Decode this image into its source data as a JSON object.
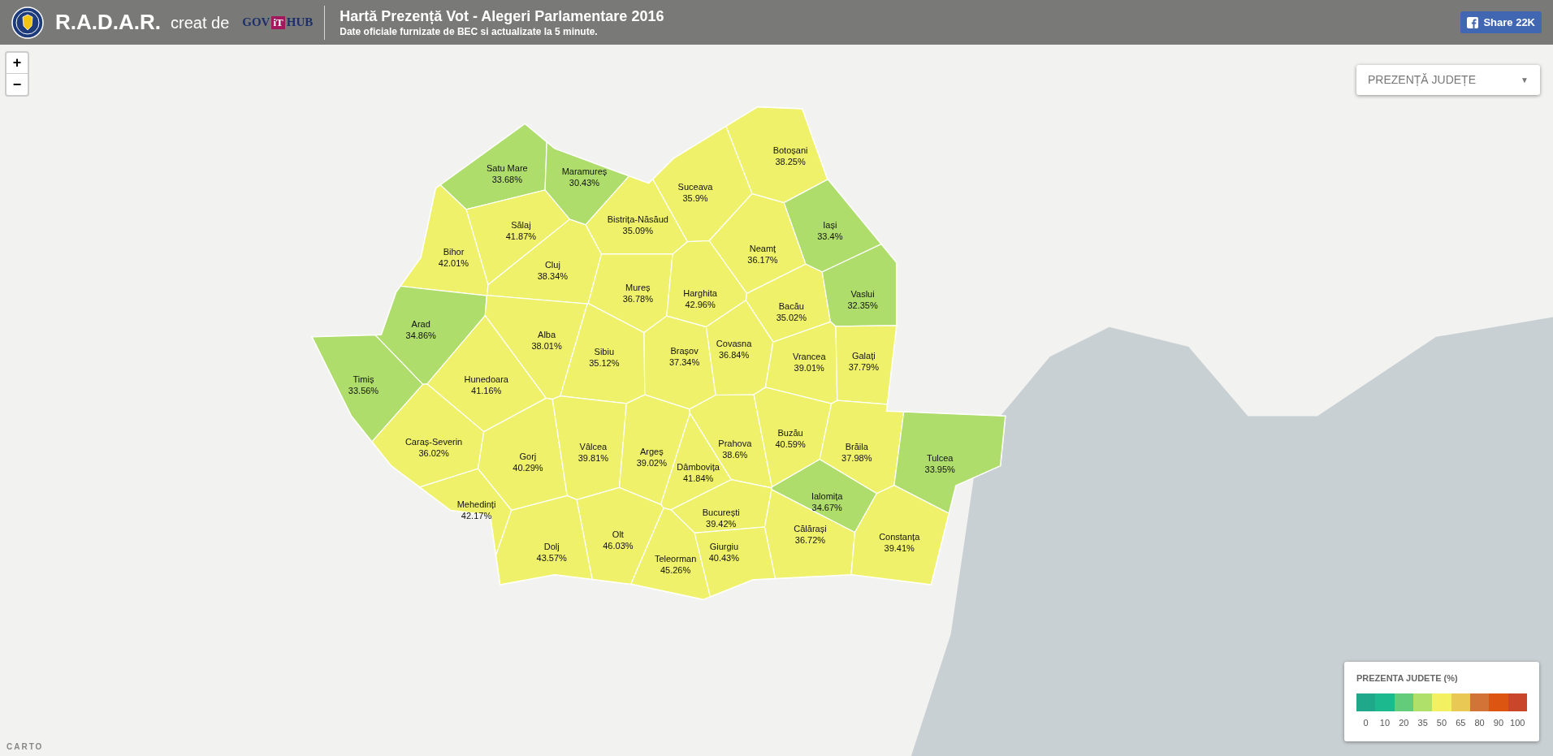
{
  "header": {
    "brand": "R.A.D.A.R.",
    "credit": "creat de",
    "partner": {
      "left": "GOV",
      "mid": "iT",
      "right": "HUB"
    },
    "title": "Hartă Prezență Vot - Alegeri Parlamentare 2016",
    "subtitle": "Date oficiale furnizate de BEC si actualizate la 5 minute.",
    "share": "Share 22K"
  },
  "zoom": [
    "+",
    "−"
  ],
  "layer_select": {
    "value": "PREZENȚĂ JUDEȚE",
    "caret": "▼"
  },
  "counties": [
    {
      "name": "Satu Mare",
      "turnout": "33.68%",
      "color": "#aedd6c"
    },
    {
      "name": "Maramureș",
      "turnout": "30.43%",
      "color": "#aedd6c"
    },
    {
      "name": "Botoșani",
      "turnout": "38.25%",
      "color": "#f0f16b"
    },
    {
      "name": "Suceava",
      "turnout": "35.9%",
      "color": "#f0f16b"
    },
    {
      "name": "Sălaj",
      "turnout": "41.87%",
      "color": "#f0f16b"
    },
    {
      "name": "Bistrița-Năsăud",
      "turnout": "35.09%",
      "color": "#f0f16b"
    },
    {
      "name": "Iași",
      "turnout": "33.4%",
      "color": "#aedd6c"
    },
    {
      "name": "Bihor",
      "turnout": "42.01%",
      "color": "#f0f16b"
    },
    {
      "name": "Cluj",
      "turnout": "38.34%",
      "color": "#f0f16b"
    },
    {
      "name": "Neamț",
      "turnout": "36.17%",
      "color": "#f0f16b"
    },
    {
      "name": "Mureș",
      "turnout": "36.78%",
      "color": "#f0f16b"
    },
    {
      "name": "Harghita",
      "turnout": "42.96%",
      "color": "#f0f16b"
    },
    {
      "name": "Bacău",
      "turnout": "35.02%",
      "color": "#f0f16b"
    },
    {
      "name": "Vaslui",
      "turnout": "32.35%",
      "color": "#aedd6c"
    },
    {
      "name": "Arad",
      "turnout": "34.86%",
      "color": "#aedd6c"
    },
    {
      "name": "Alba",
      "turnout": "38.01%",
      "color": "#f0f16b"
    },
    {
      "name": "Sibiu",
      "turnout": "35.12%",
      "color": "#f0f16b"
    },
    {
      "name": "Brașov",
      "turnout": "37.34%",
      "color": "#f0f16b"
    },
    {
      "name": "Covasna",
      "turnout": "36.84%",
      "color": "#f0f16b"
    },
    {
      "name": "Vrancea",
      "turnout": "39.01%",
      "color": "#f0f16b"
    },
    {
      "name": "Galați",
      "turnout": "37.79%",
      "color": "#f0f16b"
    },
    {
      "name": "Timiș",
      "turnout": "33.56%",
      "color": "#aedd6c"
    },
    {
      "name": "Hunedoara",
      "turnout": "41.16%",
      "color": "#f0f16b"
    },
    {
      "name": "Caraș-Severin",
      "turnout": "36.02%",
      "color": "#f0f16b"
    },
    {
      "name": "Gorj",
      "turnout": "40.29%",
      "color": "#f0f16b"
    },
    {
      "name": "Vâlcea",
      "turnout": "39.81%",
      "color": "#f0f16b"
    },
    {
      "name": "Argeș",
      "turnout": "39.02%",
      "color": "#f0f16b"
    },
    {
      "name": "Prahova",
      "turnout": "38.6%",
      "color": "#f0f16b"
    },
    {
      "name": "Buzău",
      "turnout": "40.59%",
      "color": "#f0f16b"
    },
    {
      "name": "Brăila",
      "turnout": "37.98%",
      "color": "#f0f16b"
    },
    {
      "name": "Tulcea",
      "turnout": "33.95%",
      "color": "#aedd6c"
    },
    {
      "name": "Dâmbovița",
      "turnout": "41.84%",
      "color": "#f0f16b"
    },
    {
      "name": "Ialomița",
      "turnout": "34.67%",
      "color": "#aedd6c"
    },
    {
      "name": "Mehedinți",
      "turnout": "42.17%",
      "color": "#f0f16b"
    },
    {
      "name": "București",
      "turnout": "39.42%",
      "color": "#f0f16b"
    },
    {
      "name": "Olt",
      "turnout": "46.03%",
      "color": "#f0f16b"
    },
    {
      "name": "Călărași",
      "turnout": "36.72%",
      "color": "#f0f16b"
    },
    {
      "name": "Constanța",
      "turnout": "39.41%",
      "color": "#f0f16b"
    },
    {
      "name": "Dolj",
      "turnout": "43.57%",
      "color": "#f0f16b"
    },
    {
      "name": "Teleorman",
      "turnout": "45.26%",
      "color": "#f0f16b"
    },
    {
      "name": "Giurgiu",
      "turnout": "40.43%",
      "color": "#f0f16b"
    }
  ],
  "legend": {
    "title": "PREZENTA JUDETE (%)",
    "stops": [
      {
        "label": "0",
        "color": "#1fa88a"
      },
      {
        "label": "10",
        "color": "#1db98e"
      },
      {
        "label": "20",
        "color": "#62cc7a"
      },
      {
        "label": "35",
        "color": "#aee06a"
      },
      {
        "label": "50",
        "color": "#f3f062"
      },
      {
        "label": "65",
        "color": "#e9c853"
      },
      {
        "label": "80",
        "color": "#d27338"
      },
      {
        "label": "90",
        "color": "#dc5612"
      },
      {
        "label": "100",
        "color": "#c9462a"
      }
    ]
  },
  "attribution": "CARTO"
}
